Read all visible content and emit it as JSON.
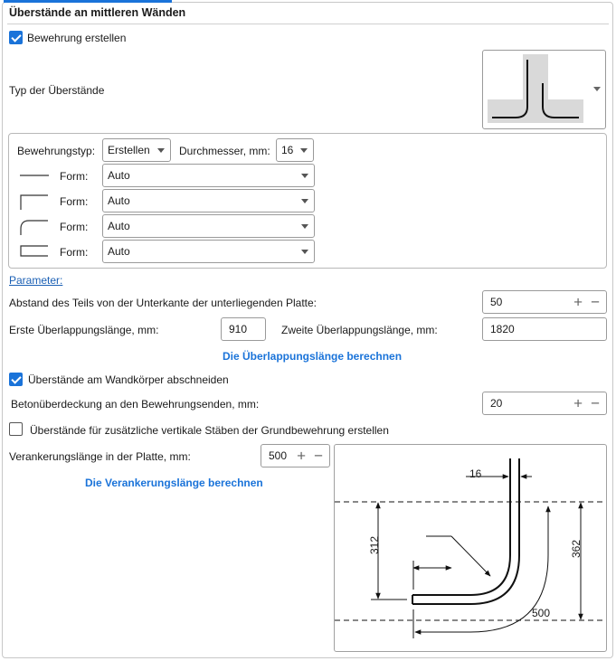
{
  "section_title": "Überstände an mittleren Wänden",
  "create_reinforcement": {
    "label": "Bewehrung erstellen",
    "checked": true
  },
  "overhang_type": {
    "label": "Typ der Überstände",
    "icon": "overhang-type-preview-icon"
  },
  "reinforcement_group": {
    "type_label": "Bewehrungstyp:",
    "type_value": "Erstellen",
    "diameter_label": "Durchmesser, mm:",
    "diameter_value": "16",
    "rows": [
      {
        "icon": "straight-bar-icon",
        "label": "Form:",
        "value": "Auto"
      },
      {
        "icon": "l-bar-icon",
        "label": "Form:",
        "value": "Auto"
      },
      {
        "icon": "bent-bar-icon",
        "label": "Form:",
        "value": "Auto"
      },
      {
        "icon": "u-bar-icon",
        "label": "Form:",
        "value": "Auto"
      }
    ]
  },
  "parameters_link": "Parameter:",
  "distance": {
    "label": "Abstand des Teils von der Unterkante der unterliegenden Platte:",
    "value": "50"
  },
  "first_overlap": {
    "label": "Erste Überlappungslänge, mm:",
    "value": "910"
  },
  "second_overlap": {
    "label": "Zweite Überlappungslänge, mm:",
    "value": "1820"
  },
  "calc_overlap": "Die Überlappungslänge berechnen",
  "cut_overhangs": {
    "label": "Überstände am Wandkörper abschneiden",
    "checked": true
  },
  "concrete_cover": {
    "label": "Betonüberdeckung an den Bewehrungsenden, mm:",
    "value": "20"
  },
  "extra_vertical": {
    "label": "Überstände für zusätzliche vertikale Stäben der Grundbewehrung erstellen",
    "checked": false
  },
  "anchorage": {
    "label": "Verankerungslänge in der Platte, mm:",
    "value": "500"
  },
  "calc_anchorage": "Die Verankerungslänge berechnen",
  "diagram": {
    "dim_top": "16",
    "dim_left": "312",
    "dim_right": "362",
    "dim_bottom": "500"
  },
  "colors": {
    "accent": "#1a73d9",
    "link": "#1a5fb4"
  }
}
